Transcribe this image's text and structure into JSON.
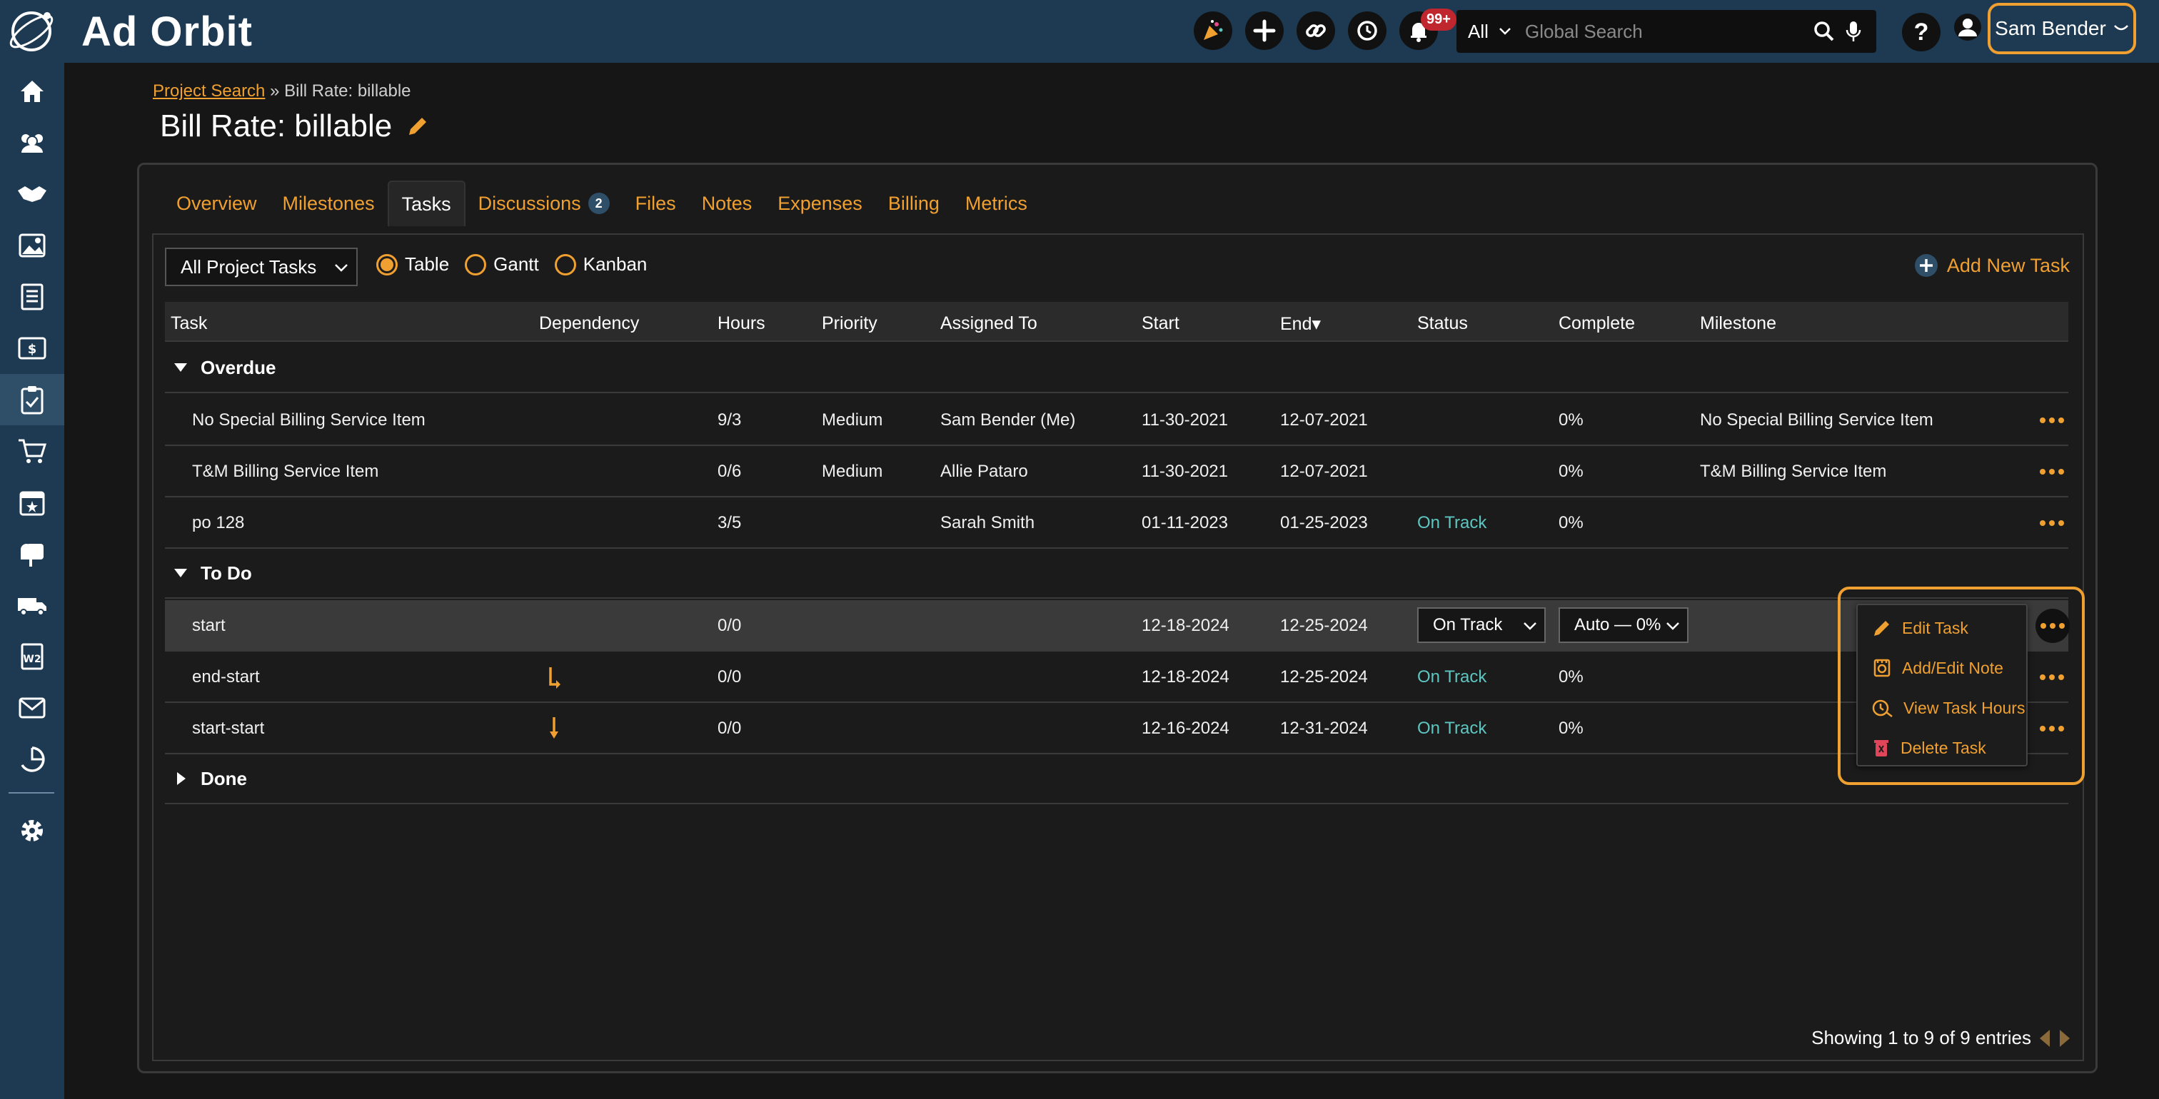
{
  "app": {
    "logo_text": "Ad Orbit"
  },
  "header": {
    "notification_count": "99+",
    "search_scope": "All",
    "search_placeholder": "Global Search",
    "user_name": "Sam Bender"
  },
  "sidebar": {
    "items": [
      "home-icon",
      "contacts-icon",
      "handshake-icon",
      "media-icon",
      "documents-icon",
      "billing-icon",
      "projects-icon",
      "cart-icon",
      "calendar-icon",
      "mailbox-icon",
      "delivery-icon",
      "w2-icon",
      "mail-icon",
      "reports-icon",
      "settings-icon"
    ],
    "active": "projects-icon"
  },
  "breadcrumb": {
    "link": "Project Search",
    "separator": "»",
    "current": "Bill Rate: billable"
  },
  "page": {
    "title": "Bill Rate: billable"
  },
  "tabs": [
    {
      "label": "Overview"
    },
    {
      "label": "Milestones"
    },
    {
      "label": "Tasks",
      "active": true
    },
    {
      "label": "Discussions",
      "count": "2"
    },
    {
      "label": "Files"
    },
    {
      "label": "Notes"
    },
    {
      "label": "Expenses"
    },
    {
      "label": "Billing"
    },
    {
      "label": "Metrics"
    }
  ],
  "toolbar": {
    "filter_value": "All Project Tasks",
    "views": [
      "Table",
      "Gantt",
      "Kanban"
    ],
    "selected_view": "Table",
    "add_label": "Add New Task"
  },
  "table": {
    "columns": [
      "Task",
      "Dependency",
      "Hours",
      "Priority",
      "Assigned To",
      "Start",
      "End",
      "Status",
      "Complete",
      "Milestone"
    ],
    "sort_indicator": "▾",
    "groups": [
      {
        "name": "Overdue",
        "expanded": true,
        "rows": [
          {
            "task": "No Special Billing Service Item",
            "dependency": "",
            "hours": "9/3",
            "priority": "Medium",
            "assigned": "Sam Bender (Me)",
            "start": "11-30-2021",
            "end": "12-07-2021",
            "status": "",
            "complete": "0%",
            "milestone": "No Special Billing Service Item"
          },
          {
            "task": "T&M Billing Service Item",
            "dependency": "",
            "hours": "0/6",
            "priority": "Medium",
            "assigned": "Allie Pataro",
            "start": "11-30-2021",
            "end": "12-07-2021",
            "status": "",
            "complete": "0%",
            "milestone": "T&M Billing Service Item"
          },
          {
            "task": "po 128",
            "dependency": "",
            "hours": "3/5",
            "priority": "",
            "assigned": "Sarah Smith",
            "start": "01-11-2023",
            "end": "01-25-2023",
            "status": "On Track",
            "complete": "0%",
            "milestone": ""
          }
        ]
      },
      {
        "name": "To Do",
        "expanded": true,
        "rows": [
          {
            "task": "start",
            "dependency": "",
            "hours": "0/0",
            "priority": "",
            "assigned": "",
            "start": "12-18-2024",
            "end": "12-25-2024",
            "status_select": "On Track",
            "complete_select": "Auto — 0%",
            "milestone": ""
          },
          {
            "task": "end-start",
            "dependency": "end-start-icon",
            "hours": "0/0",
            "priority": "",
            "assigned": "",
            "start": "12-18-2024",
            "end": "12-25-2024",
            "status": "On Track",
            "complete": "0%",
            "milestone": ""
          },
          {
            "task": "start-start",
            "dependency": "start-start-icon",
            "hours": "0/0",
            "priority": "",
            "assigned": "",
            "start": "12-16-2024",
            "end": "12-31-2024",
            "status": "On Track",
            "complete": "0%",
            "milestone": ""
          }
        ]
      },
      {
        "name": "Done",
        "expanded": false,
        "rows": []
      }
    ]
  },
  "row_menu": {
    "items": [
      {
        "label": "Edit Task",
        "icon": "pencil-icon"
      },
      {
        "label": "Add/Edit Note",
        "icon": "note-icon"
      },
      {
        "label": "View Task Hours",
        "icon": "clock-hours-icon"
      },
      {
        "label": "Delete Task",
        "icon": "trash-icon"
      }
    ]
  },
  "pager": {
    "text": "Showing 1 to 9 of 9 entries"
  },
  "colors": {
    "accent": "#f0a030",
    "nav": "#1d3a52",
    "status_on_track": "#5ec6c0",
    "badge": "#c0262d"
  }
}
